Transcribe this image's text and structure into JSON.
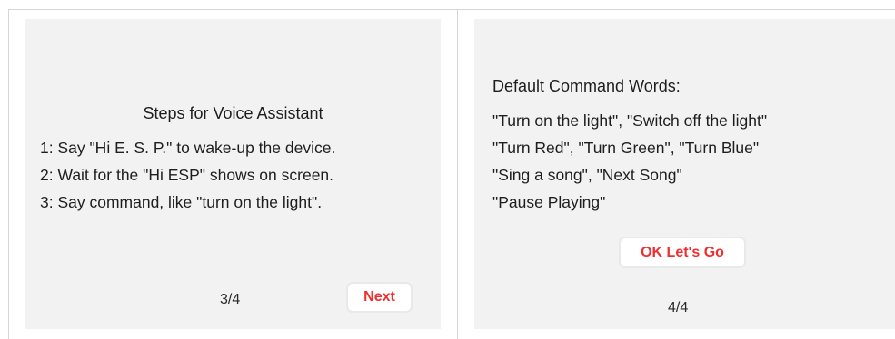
{
  "left_screen": {
    "title": "Steps for Voice Assistant",
    "steps": [
      "1: Say \"Hi E. S. P.\" to wake-up the device.",
      "2: Wait for the \"Hi ESP\" shows on screen.",
      "3: Say command, like \"turn on the light\"."
    ],
    "page_indicator": "3/4",
    "next_label": "Next"
  },
  "right_screen": {
    "title": "Default Command Words:",
    "commands": [
      "\"Turn on the light\", \"Switch off the light\"",
      "\"Turn Red\", \"Turn Green\", \"Turn Blue\"",
      "\"Sing a song\", \"Next Song\"",
      "\"Pause Playing\""
    ],
    "go_label": "OK Let's Go",
    "page_indicator": "4/4"
  },
  "colors": {
    "panel_background": "#f2f2f2",
    "button_text": "#ef2f2f",
    "button_border": "#e9e9e9",
    "frame_line": "#d6d6d6"
  }
}
